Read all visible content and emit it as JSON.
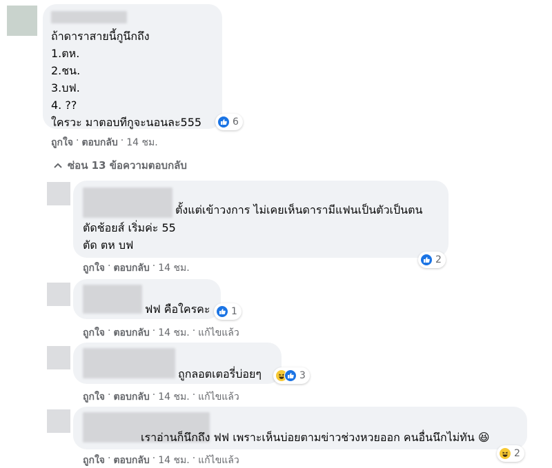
{
  "comment_main": {
    "lines": [
      "ถ้าดาราสายนี้กูนึกถึง",
      "1.ตห.",
      "2.ชน.",
      "3.บฟ.",
      "4. ??",
      "ใครวะ มาตอบทีกูจะนอนละ555"
    ],
    "reaction_count": "6",
    "actions": {
      "like": "ถูกใจ",
      "sep": "·",
      "reply": "ตอบกลับ",
      "time": "14 ชม."
    }
  },
  "hide_replies_label": "ซ่อน 13 ข้อความตอบกลับ",
  "replies": [
    {
      "lines": [
        "ตั้งแต่เข้าวงการ ไม่เคยเห็นดารามีแฟนเป็นตัวเป็นตน",
        "ตัดช้อยส์ เริ่มค่ะ 55",
        "ตัด ตห บฟ"
      ],
      "reaction_count": "2",
      "actions": {
        "like": "ถูกใจ",
        "sep": "·",
        "reply": "ตอบกลับ",
        "time": "14 ชม."
      }
    },
    {
      "lines": [
        "ฟฟ คือใครคะ"
      ],
      "reaction_count": "1",
      "actions": {
        "like": "ถูกใจ",
        "sep": "·",
        "reply": "ตอบกลับ",
        "time": "14 ชม.",
        "edited": "แก้ไขแล้ว"
      }
    },
    {
      "lines": [
        "ถูกลอตเตอรี่บ่อยๆ"
      ],
      "reaction_count": "3",
      "actions": {
        "like": "ถูกใจ",
        "sep": "·",
        "reply": "ตอบกลับ",
        "time": "14 ชม.",
        "edited": "แก้ไขแล้ว"
      }
    },
    {
      "lines": [
        "เราอ่านก็นึกถึง ฟฟ เพราะเห็นบ่อยตามข่าวช่วงหวยออก คนอื่นนึกไม่ทัน 😆"
      ],
      "reaction_count": "2",
      "actions": {
        "like": "ถูกใจ",
        "sep": "·",
        "reply": "ตอบกลับ",
        "time": "14 ชม.",
        "edited": "แก้ไขแล้ว"
      }
    }
  ],
  "colors": {
    "bubble": "#f0f2f5",
    "like_blue": "#1b74e4",
    "haha_yellow": "#f7c934",
    "meta_gray": "#65676b"
  },
  "icons": [
    "like-icon",
    "haha-icon",
    "chevron-up-icon"
  ]
}
